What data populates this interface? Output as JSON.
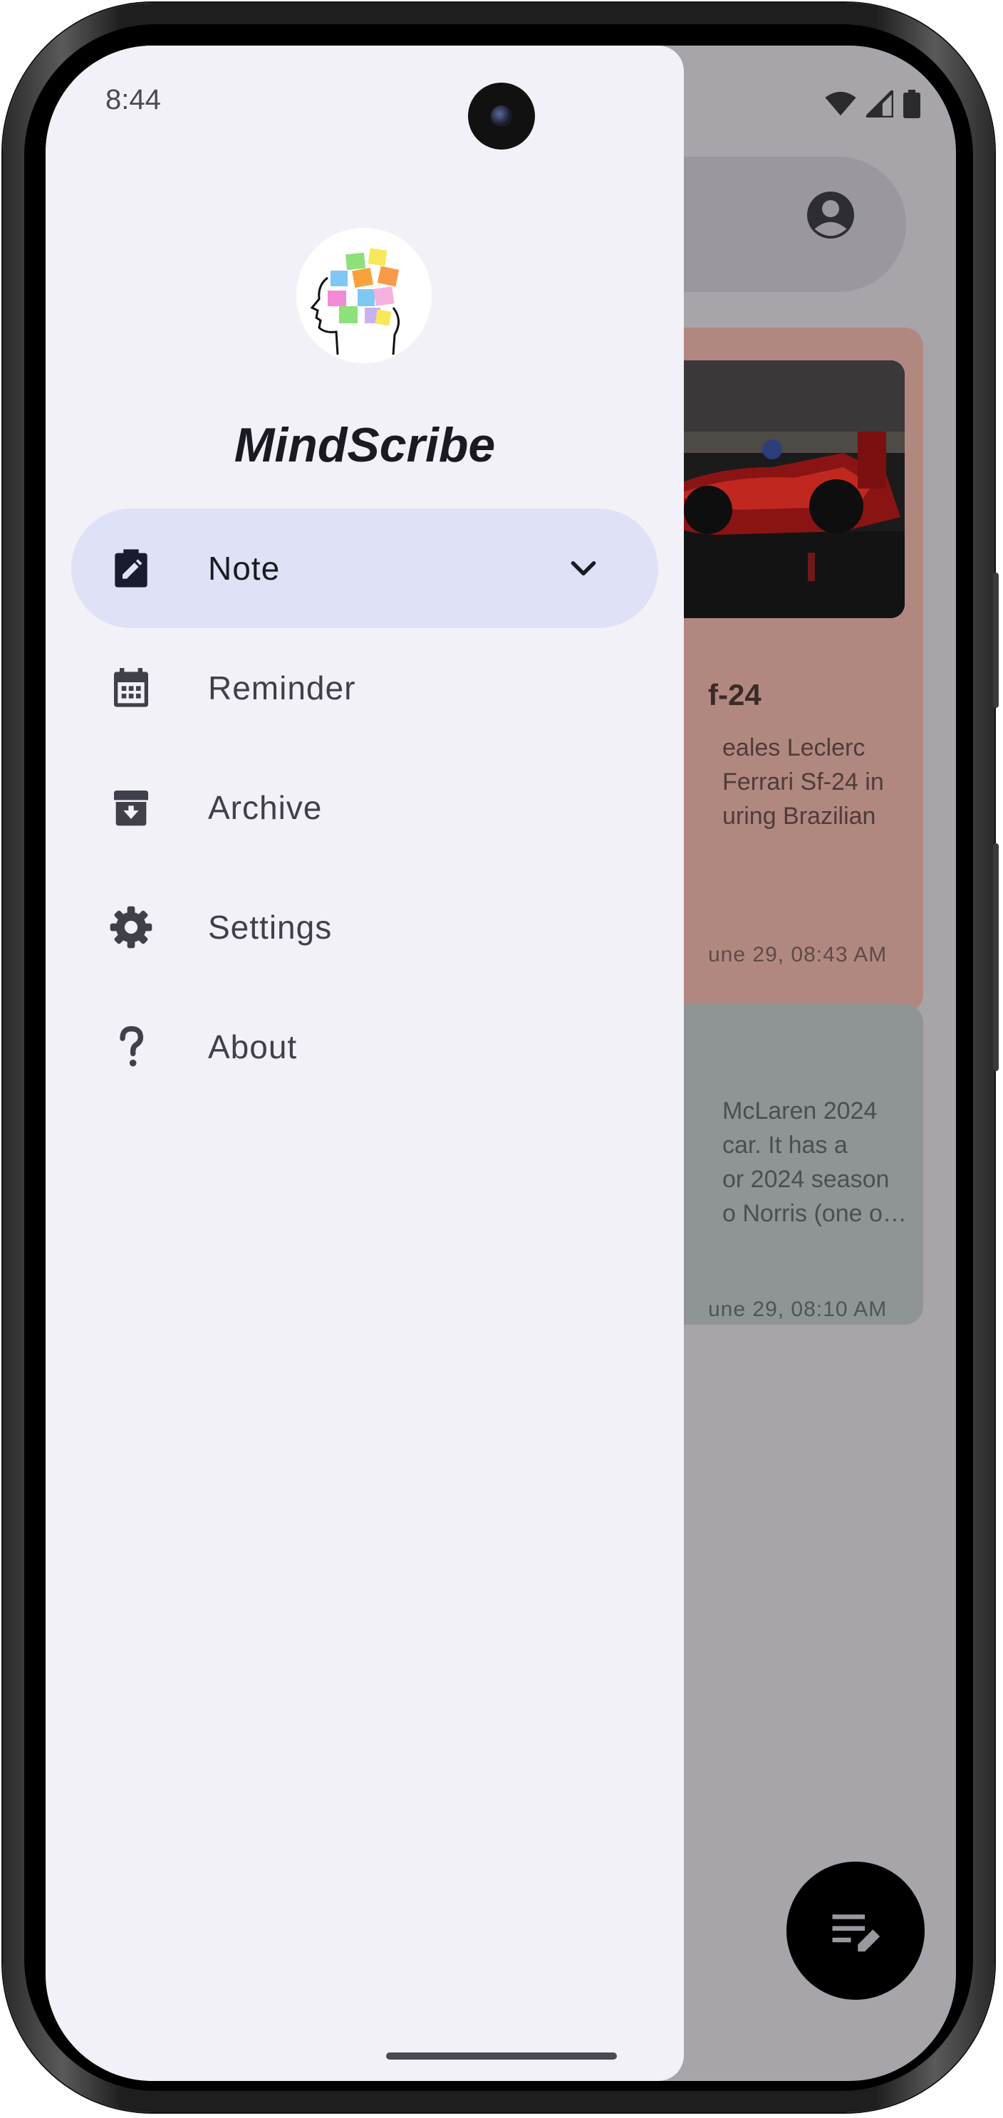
{
  "status_bar": {
    "time": "8:44"
  },
  "drawer": {
    "app_name": "MindScribe",
    "nav_items": [
      {
        "label": "Note",
        "icon": "note-edit-icon",
        "active": true,
        "expandable": true
      },
      {
        "label": "Reminder",
        "icon": "calendar-icon"
      },
      {
        "label": "Archive",
        "icon": "archive-icon"
      },
      {
        "label": "Settings",
        "icon": "gear-icon"
      },
      {
        "label": "About",
        "icon": "question-mark-icon"
      }
    ],
    "active_color": "#dfe1f6",
    "background_color": "#f2f1f8"
  },
  "background_app": {
    "notes": [
      {
        "title_partial": "f-24",
        "body_partial": "eales Leclerc\nFerrari Sf-24 in\nuring Brazilian",
        "date_partial": "une 29, 08:43 AM",
        "color": "#b18880"
      },
      {
        "body_partial": "McLaren 2024\ncar. It has a\nor 2024 season\no Norris (one o…",
        "date_partial": "une 29, 08:10 AM",
        "color": "#8f9495"
      }
    ],
    "fab_icon": "new-note-icon"
  }
}
